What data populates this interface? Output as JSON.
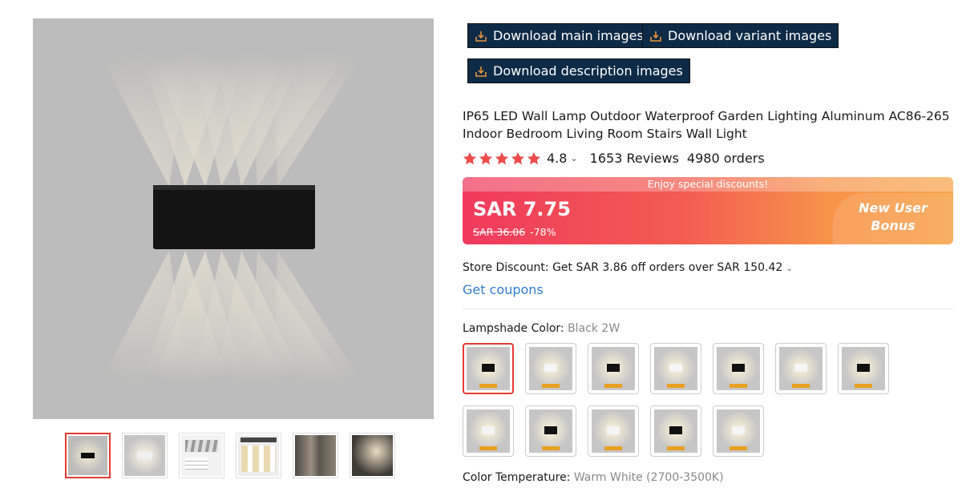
{
  "downloads": {
    "main": "Download main images",
    "variant": "Download variant images",
    "description": "Download description images"
  },
  "product": {
    "title": "IP65 LED Wall Lamp Outdoor Waterproof Garden Lighting Aluminum AC86-265 Indoor Bedroom Living Room Stairs Wall Light"
  },
  "rating": {
    "score": "4.8",
    "stars": 5,
    "reviews": "1653 Reviews",
    "orders": "4980 orders"
  },
  "price": {
    "banner": "Enjoy special discounts!",
    "current": "SAR 7.75",
    "original": "SAR 36.06",
    "discount": "-78%",
    "bonus_line1": "New User",
    "bonus_line2": "Bonus"
  },
  "store": {
    "discount": "Store Discount: Get SAR 3.86 off orders over SAR 150.42",
    "coupons": "Get coupons"
  },
  "variants": {
    "lampshade_label": "Lampshade Color:",
    "lampshade_value": "Black 2W",
    "temperature_label": "Color Temperature:",
    "temperature_value": "Warm White (2700-3500K)",
    "swatches": [
      {
        "shade": "black"
      },
      {
        "shade": "white"
      },
      {
        "shade": "black"
      },
      {
        "shade": "white"
      },
      {
        "shade": "black"
      },
      {
        "shade": "white"
      },
      {
        "shade": "black"
      },
      {
        "shade": "white"
      },
      {
        "shade": "black"
      },
      {
        "shade": "white"
      },
      {
        "shade": "black"
      },
      {
        "shade": "white"
      }
    ]
  },
  "colors": {
    "accent_red": "#e43b2f",
    "button_bg": "#0d2b46",
    "link_blue": "#2e7fd1",
    "star": "#f04a4a"
  }
}
